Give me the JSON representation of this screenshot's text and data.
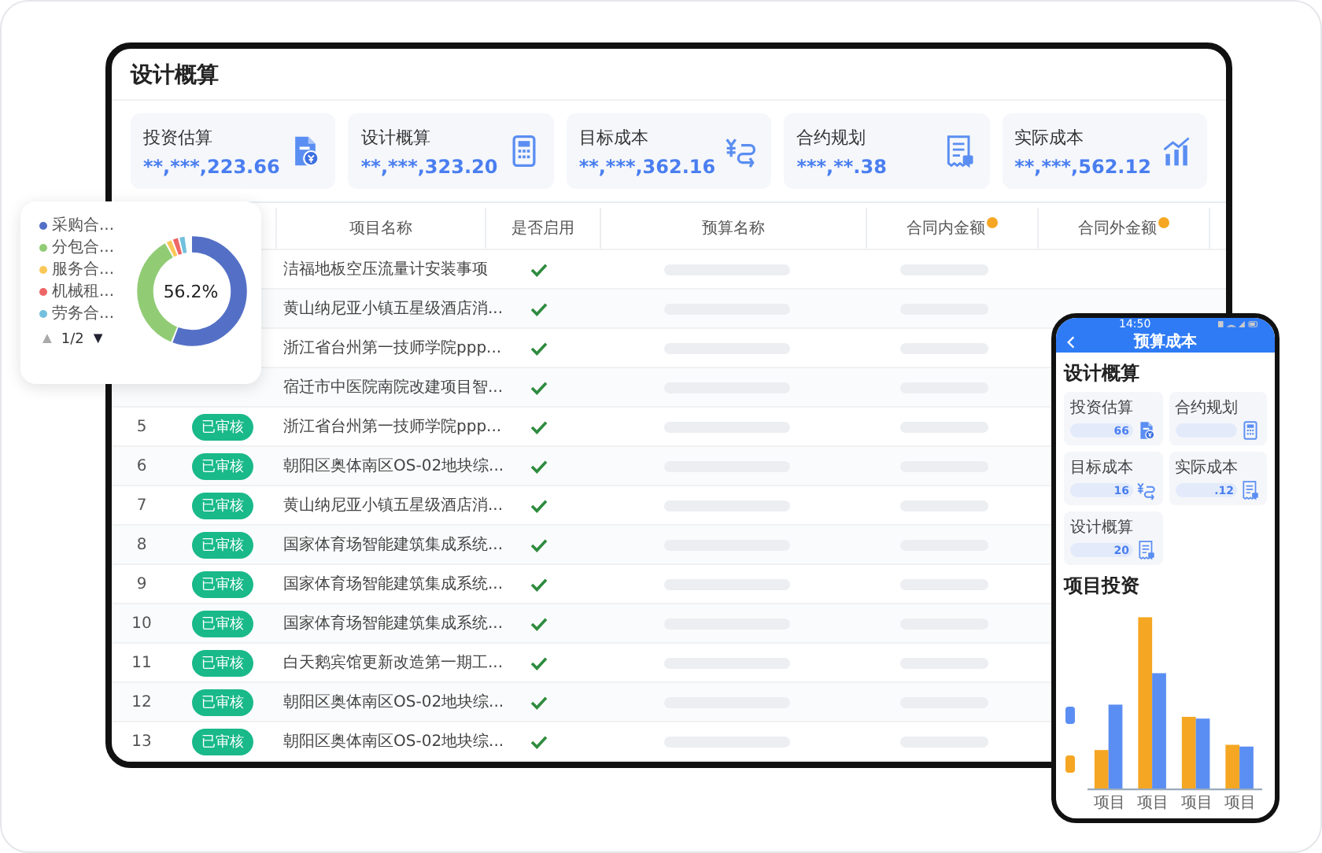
{
  "tablet": {
    "title": "设计概算",
    "cards": [
      {
        "label": "投资估算",
        "value": "**,***,223.66"
      },
      {
        "label": "设计概算",
        "value": "**,***,323.20"
      },
      {
        "label": "目标成本",
        "value": "**,***,362.16"
      },
      {
        "label": "合约规划",
        "value": "***,**.38"
      },
      {
        "label": "实际成本",
        "value": "**,***,562.12"
      }
    ],
    "columns": [
      {
        "label": "项目名称",
        "hint": false
      },
      {
        "label": "是否启用",
        "hint": false
      },
      {
        "label": "预算名称",
        "hint": false
      },
      {
        "label": "合同内金额",
        "hint": true
      },
      {
        "label": "合同外金额",
        "hint": true
      }
    ],
    "rows": [
      {
        "name": "洁福地板空压流量计安装事项",
        "enabled": true
      },
      {
        "name": "黄山纳尼亚小镇五星级酒店消...",
        "enabled": true
      },
      {
        "name": "浙江省台州第一技师学院ppp...",
        "enabled": true
      },
      {
        "name": "宿迁市中医院南院改建项目智...",
        "enabled": true
      },
      {
        "index": "5",
        "status": "已审核",
        "name": "浙江省台州第一技师学院ppp...",
        "enabled": true
      },
      {
        "index": "6",
        "status": "已审核",
        "name": "朝阳区奥体南区OS-02地块综...",
        "enabled": true
      },
      {
        "index": "7",
        "status": "已审核",
        "name": "黄山纳尼亚小镇五星级酒店消...",
        "enabled": true
      },
      {
        "index": "8",
        "status": "已审核",
        "name": "国家体育场智能建筑集成系统...",
        "enabled": true
      },
      {
        "index": "9",
        "status": "已审核",
        "name": "国家体育场智能建筑集成系统...",
        "enabled": true
      },
      {
        "index": "10",
        "status": "已审核",
        "name": "国家体育场智能建筑集成系统...",
        "enabled": true
      },
      {
        "index": "11",
        "status": "已审核",
        "name": "白天鹅宾馆更新改造第一期工...",
        "enabled": true
      },
      {
        "index": "12",
        "status": "已审核",
        "name": "朝阳区奥体南区OS-02地块综...",
        "enabled": true
      },
      {
        "index": "13",
        "status": "已审核",
        "name": "朝阳区奥体南区OS-02地块综...",
        "enabled": true
      }
    ]
  },
  "donut": {
    "center_label": "56.2%",
    "legend": [
      {
        "label": "采购合...",
        "color": "#5470c6"
      },
      {
        "label": "分包合...",
        "color": "#91cc75"
      },
      {
        "label": "服务合...",
        "color": "#fac858"
      },
      {
        "label": "机械租...",
        "color": "#ee6666"
      },
      {
        "label": "劳务合...",
        "color": "#73c0de"
      }
    ],
    "prev": {
      "glyph": "▲",
      "disabled": true
    },
    "page": "1/2",
    "next": {
      "glyph": "▼",
      "disabled": false
    }
  },
  "phone": {
    "time": "14:50",
    "header": "预算成本",
    "title": "设计概算",
    "cards": [
      {
        "label": "投资估算",
        "value": "66"
      },
      {
        "label": "合约规划"
      },
      {
        "label": "目标成本",
        "value": "16"
      },
      {
        "label": "实际成本",
        "value": ".12"
      },
      {
        "label": "设计概算",
        "value": "20"
      }
    ],
    "section": "项目投资",
    "chart_labels": [
      "项目",
      "项目",
      "项目",
      "项目"
    ]
  }
}
